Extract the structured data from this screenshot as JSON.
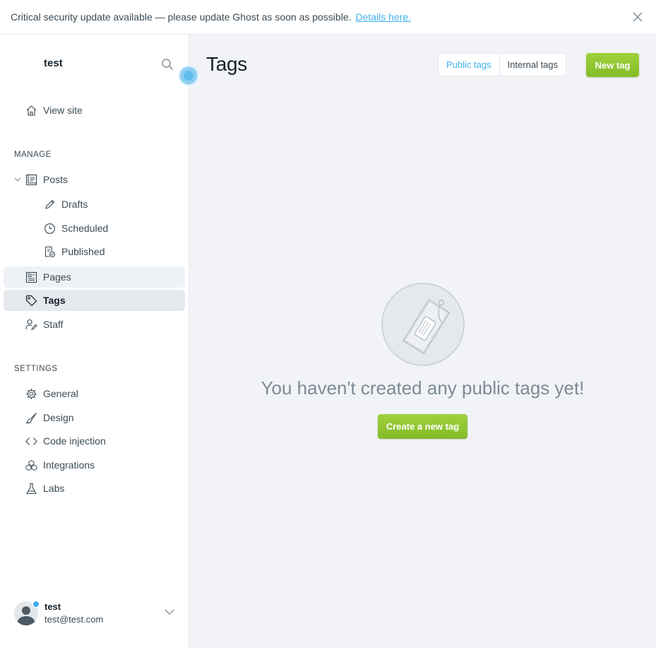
{
  "banner": {
    "message": "Critical security update available — please update Ghost as soon as possible.",
    "link": "Details here."
  },
  "sidebar": {
    "site_title": "test",
    "view_site": "View site",
    "manage_heading": "MANAGE",
    "posts": "Posts",
    "drafts": "Drafts",
    "scheduled": "Scheduled",
    "published": "Published",
    "pages": "Pages",
    "tags": "Tags",
    "staff": "Staff",
    "settings_heading": "SETTINGS",
    "general": "General",
    "design": "Design",
    "code_injection": "Code injection",
    "integrations": "Integrations",
    "labs": "Labs"
  },
  "user": {
    "name": "test",
    "email": "test@test.com"
  },
  "main": {
    "title": "Tags",
    "tab_public": "Public tags",
    "tab_internal": "Internal tags",
    "new_tag": "New tag",
    "empty_message": "You haven't created any public tags yet!",
    "create_button": "Create a new tag"
  },
  "colors": {
    "accent": "#3eb0ef",
    "green": "#9fd23d",
    "main_bg": "#f1f3f6"
  }
}
